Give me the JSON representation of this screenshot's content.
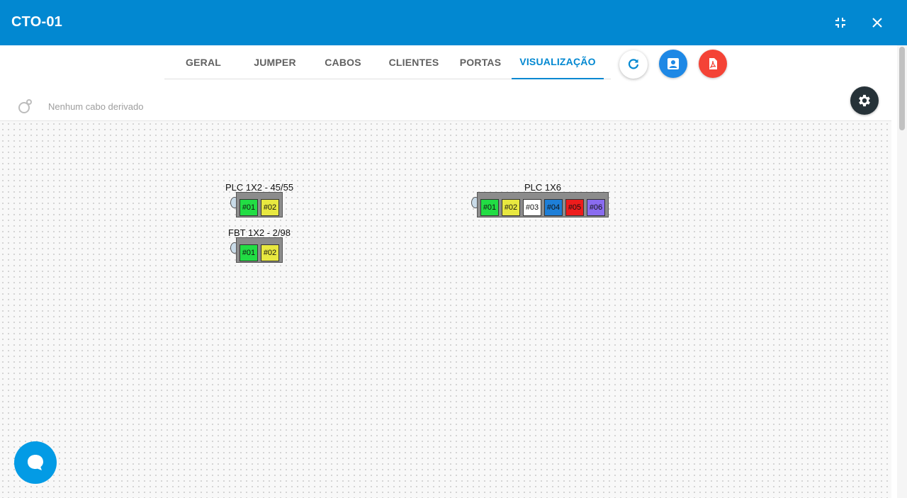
{
  "window": {
    "title": "CTO-01"
  },
  "tabs": [
    "GERAL",
    "JUMPER",
    "CABOS",
    "CLIENTES",
    "PORTAS",
    "VISUALIZAÇÃO"
  ],
  "active_tab": "VISUALIZAÇÃO",
  "derived": {
    "text": "Nenhum cabo derivado"
  },
  "splitters": [
    {
      "label": "PLC 1X2 - 45/55",
      "ports": [
        {
          "label": "#01",
          "color": "#22dd44"
        },
        {
          "label": "#02",
          "color": "#e8e840"
        }
      ]
    },
    {
      "label": "FBT 1X2 - 2/98",
      "ports": [
        {
          "label": "#01",
          "color": "#22dd44"
        },
        {
          "label": "#02",
          "color": "#e8e840"
        }
      ]
    },
    {
      "label": "PLC 1X6",
      "ports": [
        {
          "label": "#01",
          "color": "#22dd44"
        },
        {
          "label": "#02",
          "color": "#e8e840"
        },
        {
          "label": "#03",
          "color": "#ffffff"
        },
        {
          "label": "#04",
          "color": "#1e7fd8"
        },
        {
          "label": "#05",
          "color": "#ee1c1c"
        },
        {
          "label": "#06",
          "color": "#8a6cf0"
        }
      ]
    }
  ],
  "colors": {
    "header": "#0288d1",
    "accent": "#0288d1",
    "pdf": "#f44336",
    "client": "#1e88e5",
    "settings": "#263238",
    "chat": "#039be5"
  },
  "icons": {
    "minimize": "fullscreen-exit-icon",
    "close": "close-icon",
    "refresh": "refresh-icon",
    "client": "account-box-icon",
    "pdf": "pdf-icon",
    "settings": "gear-icon",
    "derived": "cable-derive-icon",
    "chat": "chat-bubble-icon"
  }
}
